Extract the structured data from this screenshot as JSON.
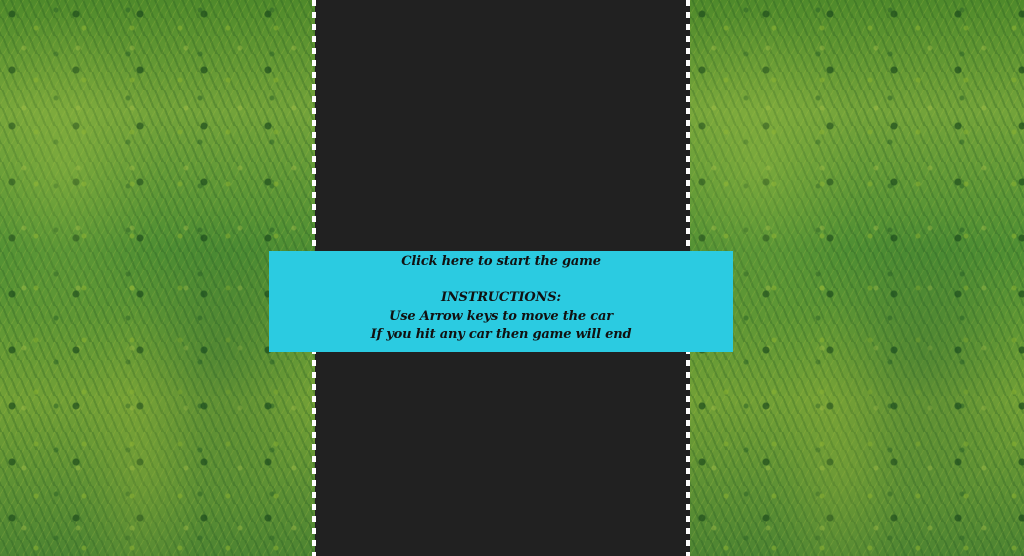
{
  "scene": {
    "type": "car racing game start screen",
    "background": "grass",
    "road_color": "#212121",
    "panel_color": "#2bcbe1",
    "road_edge_color": "#ffffff"
  },
  "start_panel": {
    "start_text": "Click here to start the game",
    "instructions_heading": "INSTRUCTIONS:",
    "instruction_1": "Use Arrow keys to move the car",
    "instruction_2": "If you hit any car then game will end"
  }
}
